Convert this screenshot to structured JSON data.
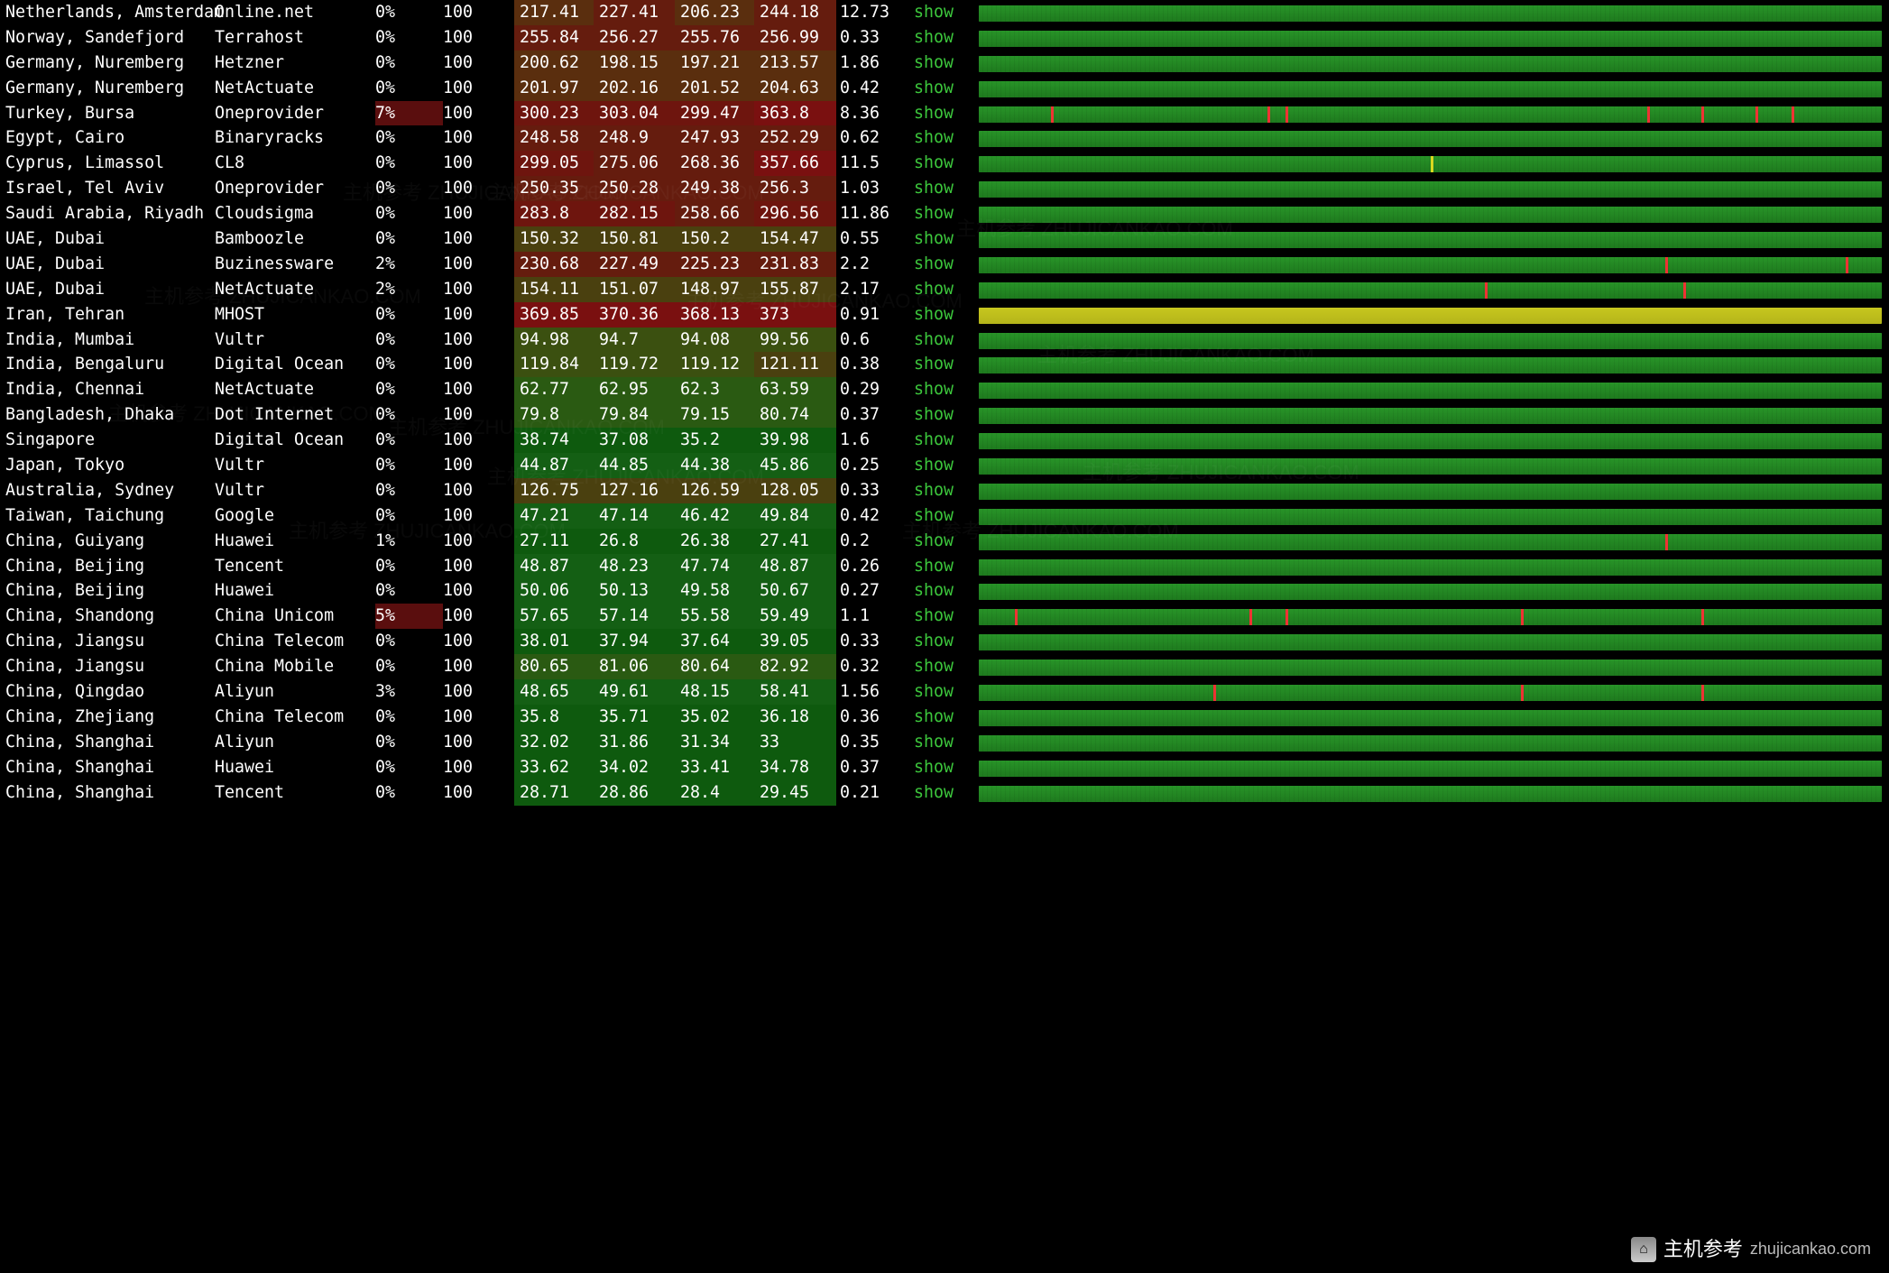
{
  "show_label": "show",
  "logo": {
    "cn": "主机参考",
    "domain": "zhujicankao.com"
  },
  "rows": [
    {
      "location": "Netherlands, Amsterdam",
      "provider": "Online.net",
      "loss": "0%",
      "sent": "100",
      "last": "217.41",
      "avg": "227.41",
      "best": "206.23",
      "wrst": "244.18",
      "stdev": "12.73",
      "chart": "green",
      "spikes": []
    },
    {
      "location": "Norway, Sandefjord",
      "provider": "Terrahost",
      "loss": "0%",
      "sent": "100",
      "last": "255.84",
      "avg": "256.27",
      "best": "255.76",
      "wrst": "256.99",
      "stdev": "0.33",
      "chart": "green",
      "spikes": []
    },
    {
      "location": "Germany, Nuremberg",
      "provider": "Hetzner",
      "loss": "0%",
      "sent": "100",
      "last": "200.62",
      "avg": "198.15",
      "best": "197.21",
      "wrst": "213.57",
      "stdev": "1.86",
      "chart": "green",
      "spikes": []
    },
    {
      "location": "Germany, Nuremberg",
      "provider": "NetActuate",
      "loss": "0%",
      "sent": "100",
      "last": "201.97",
      "avg": "202.16",
      "best": "201.52",
      "wrst": "204.63",
      "stdev": "0.42",
      "chart": "green",
      "spikes": []
    },
    {
      "location": "Turkey, Bursa",
      "provider": "Oneprovider",
      "loss": "7%",
      "sent": "100",
      "last": "300.23",
      "avg": "303.04",
      "best": "299.47",
      "wrst": "363.8",
      "stdev": "8.36",
      "chart": "green",
      "spikes": [
        8,
        32,
        34,
        74,
        80,
        86,
        90
      ],
      "loss_bad": true
    },
    {
      "location": "Egypt, Cairo",
      "provider": "Binaryracks",
      "loss": "0%",
      "sent": "100",
      "last": "248.58",
      "avg": "248.9",
      "best": "247.93",
      "wrst": "252.29",
      "stdev": "0.62",
      "chart": "green",
      "spikes": []
    },
    {
      "location": "Cyprus, Limassol",
      "provider": "CL8",
      "loss": "0%",
      "sent": "100",
      "last": "299.05",
      "avg": "275.06",
      "best": "268.36",
      "wrst": "357.66",
      "stdev": "11.5",
      "chart": "green",
      "spikes": [
        {
          "pos": 50,
          "y": true
        }
      ]
    },
    {
      "location": "Israel, Tel Aviv",
      "provider": "Oneprovider",
      "loss": "0%",
      "sent": "100",
      "last": "250.35",
      "avg": "250.28",
      "best": "249.38",
      "wrst": "256.3",
      "stdev": "1.03",
      "chart": "green",
      "spikes": []
    },
    {
      "location": "Saudi Arabia, Riyadh",
      "provider": "Cloudsigma",
      "loss": "0%",
      "sent": "100",
      "last": "283.8",
      "avg": "282.15",
      "best": "258.66",
      "wrst": "296.56",
      "stdev": "11.86",
      "chart": "green",
      "spikes": []
    },
    {
      "location": "UAE, Dubai",
      "provider": "Bamboozle",
      "loss": "0%",
      "sent": "100",
      "last": "150.32",
      "avg": "150.81",
      "best": "150.2",
      "wrst": "154.47",
      "stdev": "0.55",
      "chart": "green",
      "spikes": []
    },
    {
      "location": "UAE, Dubai",
      "provider": "Buzinessware",
      "loss": "2%",
      "sent": "100",
      "last": "230.68",
      "avg": "227.49",
      "best": "225.23",
      "wrst": "231.83",
      "stdev": "2.2",
      "chart": "green",
      "spikes": [
        76,
        96
      ]
    },
    {
      "location": "UAE, Dubai",
      "provider": "NetActuate",
      "loss": "2%",
      "sent": "100",
      "last": "154.11",
      "avg": "151.07",
      "best": "148.97",
      "wrst": "155.87",
      "stdev": "2.17",
      "chart": "green",
      "spikes": [
        56,
        78
      ]
    },
    {
      "location": "Iran, Tehran",
      "provider": "MHOST",
      "loss": "0%",
      "sent": "100",
      "last": "369.85",
      "avg": "370.36",
      "best": "368.13",
      "wrst": "373",
      "stdev": "0.91",
      "chart": "yellow",
      "spikes": []
    },
    {
      "location": "India, Mumbai",
      "provider": "Vultr",
      "loss": "0%",
      "sent": "100",
      "last": "94.98",
      "avg": "94.7",
      "best": "94.08",
      "wrst": "99.56",
      "stdev": "0.6",
      "chart": "green",
      "spikes": []
    },
    {
      "location": "India, Bengaluru",
      "provider": "Digital Ocean",
      "loss": "0%",
      "sent": "100",
      "last": "119.84",
      "avg": "119.72",
      "best": "119.12",
      "wrst": "121.11",
      "stdev": "0.38",
      "chart": "green",
      "spikes": []
    },
    {
      "location": "India, Chennai",
      "provider": "NetActuate",
      "loss": "0%",
      "sent": "100",
      "last": "62.77",
      "avg": "62.95",
      "best": "62.3",
      "wrst": "63.59",
      "stdev": "0.29",
      "chart": "green",
      "spikes": []
    },
    {
      "location": "Bangladesh, Dhaka",
      "provider": "Dot Internet",
      "loss": "0%",
      "sent": "100",
      "last": "79.8",
      "avg": "79.84",
      "best": "79.15",
      "wrst": "80.74",
      "stdev": "0.37",
      "chart": "green",
      "spikes": []
    },
    {
      "location": "Singapore",
      "provider": "Digital Ocean",
      "loss": "0%",
      "sent": "100",
      "last": "38.74",
      "avg": "37.08",
      "best": "35.2",
      "wrst": "39.98",
      "stdev": "1.6",
      "chart": "green",
      "spikes": []
    },
    {
      "location": "Japan, Tokyo",
      "provider": "Vultr",
      "loss": "0%",
      "sent": "100",
      "last": "44.87",
      "avg": "44.85",
      "best": "44.38",
      "wrst": "45.86",
      "stdev": "0.25",
      "chart": "green",
      "spikes": []
    },
    {
      "location": "Australia, Sydney",
      "provider": "Vultr",
      "loss": "0%",
      "sent": "100",
      "last": "126.75",
      "avg": "127.16",
      "best": "126.59",
      "wrst": "128.05",
      "stdev": "0.33",
      "chart": "green",
      "spikes": []
    },
    {
      "location": "Taiwan, Taichung",
      "provider": "Google",
      "loss": "0%",
      "sent": "100",
      "last": "47.21",
      "avg": "47.14",
      "best": "46.42",
      "wrst": "49.84",
      "stdev": "0.42",
      "chart": "green",
      "spikes": []
    },
    {
      "location": "China, Guiyang",
      "provider": "Huawei",
      "loss": "1%",
      "sent": "100",
      "last": "27.11",
      "avg": "26.8",
      "best": "26.38",
      "wrst": "27.41",
      "stdev": "0.2",
      "chart": "green",
      "spikes": [
        76
      ]
    },
    {
      "location": "China, Beijing",
      "provider": "Tencent",
      "loss": "0%",
      "sent": "100",
      "last": "48.87",
      "avg": "48.23",
      "best": "47.74",
      "wrst": "48.87",
      "stdev": "0.26",
      "chart": "green",
      "spikes": []
    },
    {
      "location": "China, Beijing",
      "provider": "Huawei",
      "loss": "0%",
      "sent": "100",
      "last": "50.06",
      "avg": "50.13",
      "best": "49.58",
      "wrst": "50.67",
      "stdev": "0.27",
      "chart": "green",
      "spikes": []
    },
    {
      "location": "China, Shandong",
      "provider": "China Unicom",
      "loss": "5%",
      "sent": "100",
      "last": "57.65",
      "avg": "57.14",
      "best": "55.58",
      "wrst": "59.49",
      "stdev": "1.1",
      "chart": "green",
      "spikes": [
        4,
        30,
        34,
        60,
        80
      ],
      "loss_bad": true
    },
    {
      "location": "China, Jiangsu",
      "provider": "China Telecom",
      "loss": "0%",
      "sent": "100",
      "last": "38.01",
      "avg": "37.94",
      "best": "37.64",
      "wrst": "39.05",
      "stdev": "0.33",
      "chart": "green",
      "spikes": []
    },
    {
      "location": "China, Jiangsu",
      "provider": "China Mobile",
      "loss": "0%",
      "sent": "100",
      "last": "80.65",
      "avg": "81.06",
      "best": "80.64",
      "wrst": "82.92",
      "stdev": "0.32",
      "chart": "green",
      "spikes": []
    },
    {
      "location": "China, Qingdao",
      "provider": "Aliyun",
      "loss": "3%",
      "sent": "100",
      "last": "48.65",
      "avg": "49.61",
      "best": "48.15",
      "wrst": "58.41",
      "stdev": "1.56",
      "chart": "green",
      "spikes": [
        26,
        60,
        80
      ]
    },
    {
      "location": "China, Zhejiang",
      "provider": "China Telecom",
      "loss": "0%",
      "sent": "100",
      "last": "35.8",
      "avg": "35.71",
      "best": "35.02",
      "wrst": "36.18",
      "stdev": "0.36",
      "chart": "green",
      "spikes": []
    },
    {
      "location": "China, Shanghai",
      "provider": "Aliyun",
      "loss": "0%",
      "sent": "100",
      "last": "32.02",
      "avg": "31.86",
      "best": "31.34",
      "wrst": "33",
      "stdev": "0.35",
      "chart": "green",
      "spikes": []
    },
    {
      "location": "China, Shanghai",
      "provider": "Huawei",
      "loss": "0%",
      "sent": "100",
      "last": "33.62",
      "avg": "34.02",
      "best": "33.41",
      "wrst": "34.78",
      "stdev": "0.37",
      "chart": "green",
      "spikes": []
    },
    {
      "location": "China, Shanghai",
      "provider": "Tencent",
      "loss": "0%",
      "sent": "100",
      "last": "28.71",
      "avg": "28.86",
      "best": "28.4",
      "wrst": "29.45",
      "stdev": "0.21",
      "chart": "green",
      "spikes": []
    }
  ]
}
